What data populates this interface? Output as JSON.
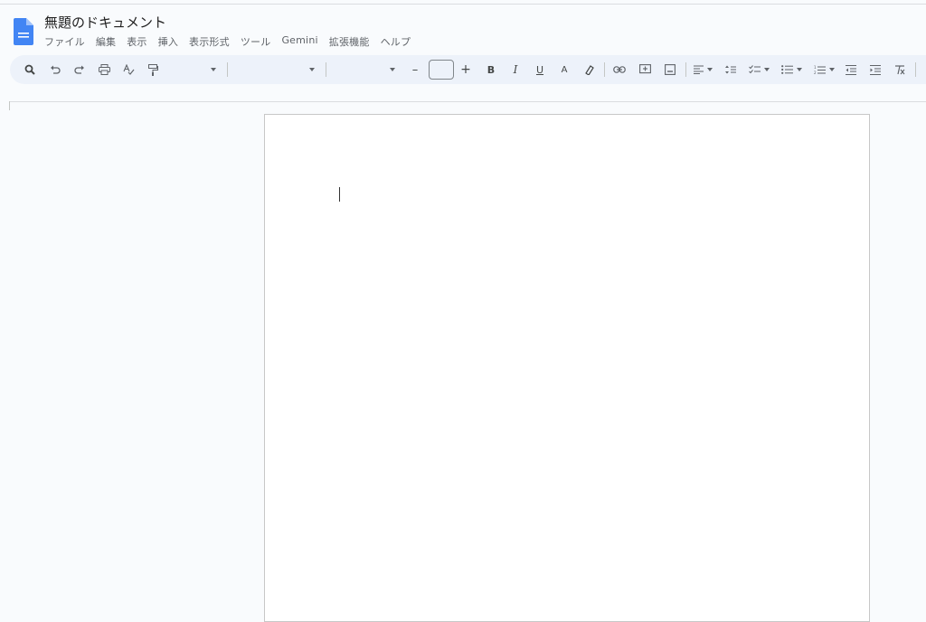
{
  "app": {
    "document_title": "無題のドキュメント"
  },
  "menu": {
    "items": [
      "ファイル",
      "編集",
      "表示",
      "挿入",
      "表示形式",
      "ツール",
      "Gemini",
      "拡張機能",
      "ヘルプ"
    ]
  },
  "toolbar": {
    "icons": [
      "search-icon",
      "undo-icon",
      "redo-icon",
      "print-icon",
      "spellcheck-icon",
      "paint-format-icon",
      "zoom-dropdown",
      "style-dropdown",
      "font-dropdown",
      "font-size-decrease-icon",
      "font-size-input",
      "font-size-increase-icon",
      "bold-button",
      "italic-button",
      "underline-button",
      "text-color-button",
      "highlight-icon",
      "link-icon",
      "comment-icon",
      "image-icon",
      "align-icon",
      "line-spacing-icon",
      "checklist-icon",
      "bulleted-list-icon",
      "numbered-list-icon",
      "decrease-indent-icon",
      "increase-indent-icon",
      "clear-formatting-icon"
    ],
    "bold_label": "B",
    "italic_label": "I",
    "underline_label": "U",
    "text_color_label": "A",
    "minus_label": "–",
    "plus_label": "+"
  },
  "colors": {
    "background": "#f9fbfd",
    "toolbar": "#edf2fa",
    "doc_icon": "#4285f4"
  }
}
